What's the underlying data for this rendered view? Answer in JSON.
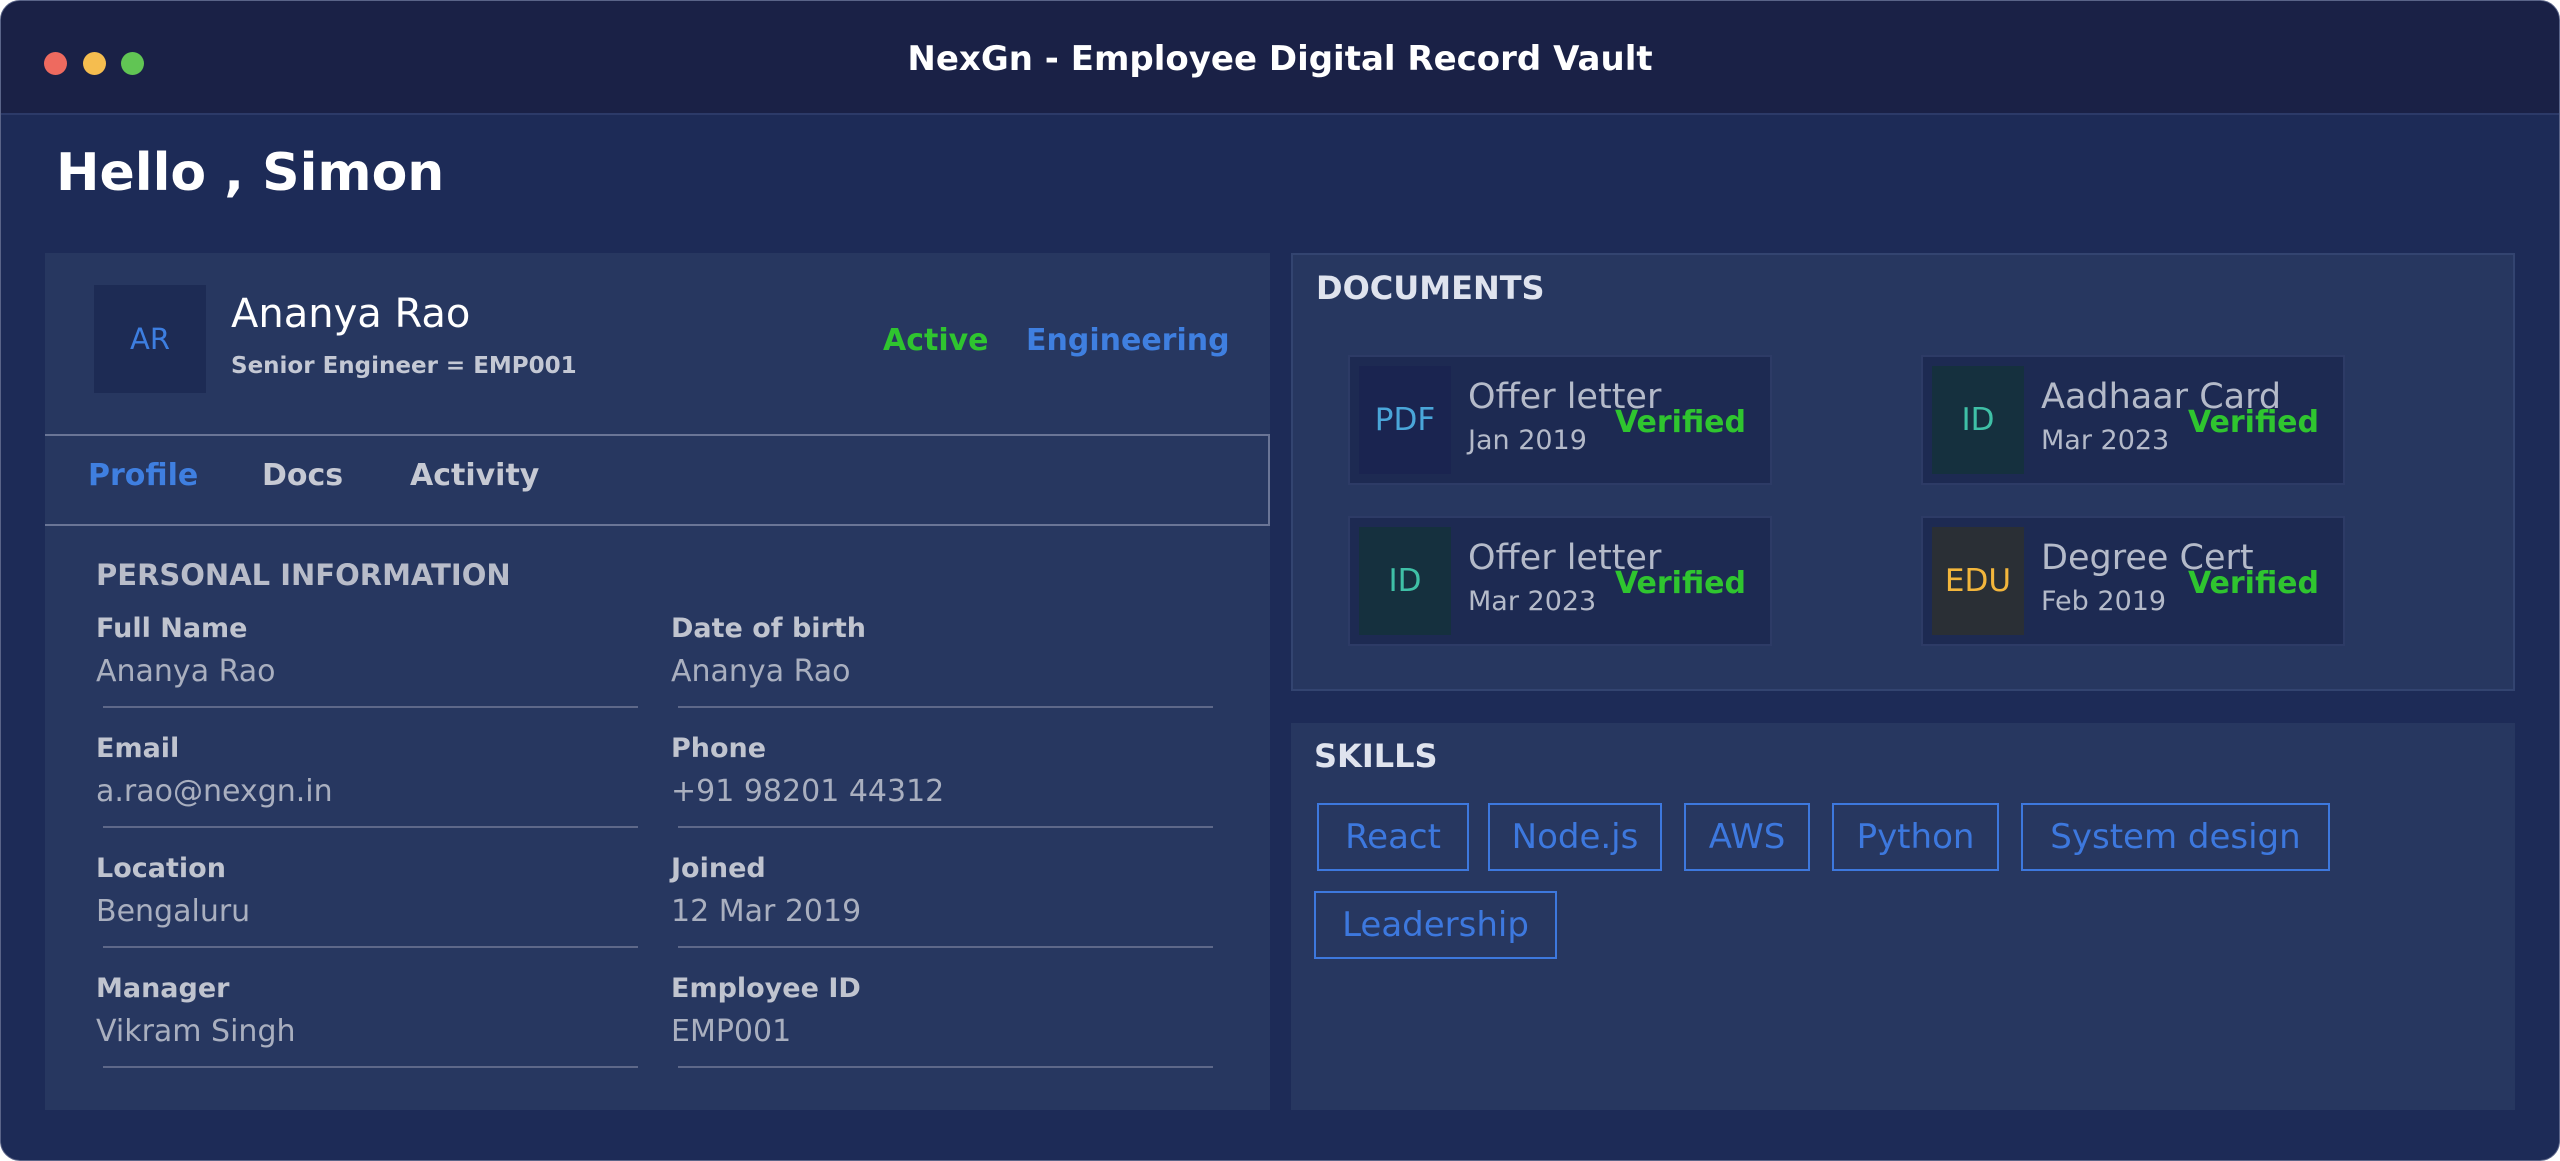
{
  "window": {
    "title": "NexGn - Employee Digital Record Vault"
  },
  "greeting": "Hello , Simon",
  "employee": {
    "initials": "AR",
    "name": "Ananya Rao",
    "subtitle": "Senior Engineer = EMP001",
    "status": "Active",
    "department": "Engineering"
  },
  "tabs": [
    "Profile",
    "Docs",
    "Activity"
  ],
  "personal": {
    "title": "PERSONAL INFORMATION",
    "fields": [
      {
        "label": "Full Name",
        "value": "Ananya Rao"
      },
      {
        "label": "Date of birth",
        "value": "Ananya Rao"
      },
      {
        "label": "Email",
        "value": "a.rao@nexgn.in"
      },
      {
        "label": "Phone",
        "value": "+91 98201 44312"
      },
      {
        "label": "Location",
        "value": "Bengaluru"
      },
      {
        "label": "Joined",
        "value": "12 Mar 2019"
      },
      {
        "label": "Manager",
        "value": "Vikram Singh"
      },
      {
        "label": "Employee ID",
        "value": "EMP001"
      }
    ]
  },
  "documents": {
    "title": "DOCUMENTS",
    "items": [
      {
        "type": "PDF",
        "name": "Offer letter",
        "date": "Jan 2019",
        "status": "Verified"
      },
      {
        "type": "ID",
        "name": "Aadhaar Card",
        "date": "Mar 2023",
        "status": "Verified"
      },
      {
        "type": "ID",
        "name": "Offer letter",
        "date": "Mar 2023",
        "status": "Verified"
      },
      {
        "type": "EDU",
        "name": "Degree Cert",
        "date": "Feb 2019",
        "status": "Verified"
      }
    ]
  },
  "skills": {
    "title": "SKILLS",
    "items": [
      "React",
      "Node.js",
      "AWS",
      "Python",
      "System design",
      "Leadership"
    ]
  },
  "colors": {
    "pdf_icon_fg": "#4aa6d9",
    "pdf_icon_bg": "#1a2450",
    "id_icon_fg": "#3fc0a6",
    "id_icon_bg": "#15303e",
    "edu_icon_fg": "#f3b63c",
    "edu_icon_bg": "#2a2f35",
    "verified": "#2fc52f",
    "accent": "#3f7fe0"
  }
}
